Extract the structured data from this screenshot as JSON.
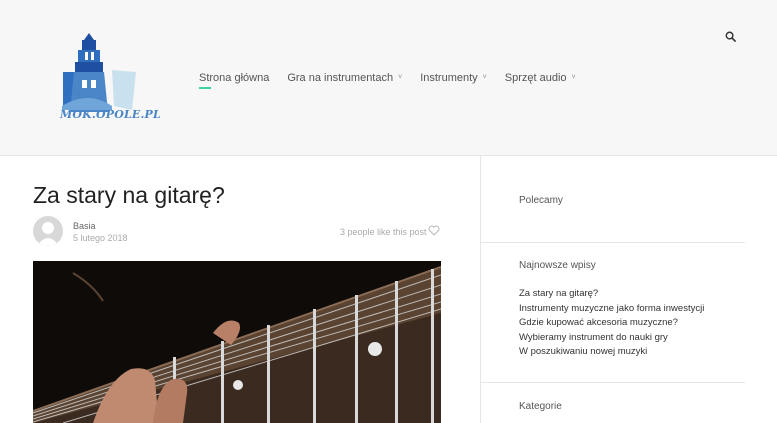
{
  "site": {
    "logo_text": "MOK.OPOLE.PL",
    "brand_color": "#4a86c7",
    "accent_color": "#3fd0a6"
  },
  "nav": {
    "items": [
      {
        "label": "Strona główna",
        "active": true,
        "has_dropdown": false
      },
      {
        "label": "Gra na instrumentach",
        "active": false,
        "has_dropdown": true
      },
      {
        "label": "Instrumenty",
        "active": false,
        "has_dropdown": true
      },
      {
        "label": "Sprzęt audio",
        "active": false,
        "has_dropdown": true
      }
    ],
    "dropdown_glyph": "˅",
    "search_icon": "search-icon"
  },
  "post": {
    "title": "Za stary na gitarę?",
    "author": "Basia",
    "date": "5 lutego 2018",
    "likes_text": "3 people like this post",
    "like_icon": "heart-icon"
  },
  "sidebar": {
    "polecamy_title": "Polecamy",
    "recent_title": "Najnowsze wpisy",
    "recent_posts": [
      "Za stary na gitarę?",
      "Instrumenty muzyczne jako forma inwestycji",
      "Gdzie kupować akcesoria muzyczne?",
      "Wybieramy instrument do nauki gry",
      "W poszukiwaniu nowej muzyki"
    ],
    "categories_title": "Kategorie"
  }
}
